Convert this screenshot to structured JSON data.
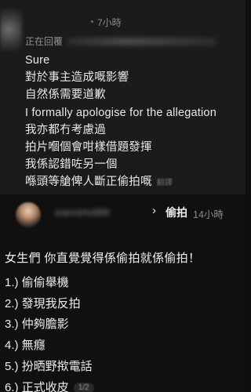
{
  "reply": {
    "time": "7小時",
    "replying_to_label": "正在回覆",
    "lines": [
      "Sure",
      "對於事主造成嘅影響",
      "自然係需要道歉",
      "I formally apologise for the allegation",
      "我亦都冇考慮過",
      "拍片嗰個會咁樣借題發揮",
      "我係認錯咗另一個",
      "喺頭等艙俾人斷正偷拍嘅"
    ],
    "translate_hint": "翻譯"
  },
  "post": {
    "username": "joanneho888",
    "chevron": "›",
    "tag": "偷拍",
    "time": "14小時",
    "headline": "女生們 你直覺覺得係偷拍就係偷拍！",
    "items": [
      "1.) 偷偷舉機",
      "2.) 發現我反拍",
      "3.) 仲夠膽影",
      "4.) 無癮",
      "5.) 扮晒野揿電話",
      "6.) 正式收皮"
    ],
    "page_indicator": "1/2"
  },
  "colors": {
    "background_top": "#1b1b1b",
    "background_bottom": "#101010",
    "text_primary": "#e9e9e9",
    "text_secondary": "#8a8a8a"
  }
}
